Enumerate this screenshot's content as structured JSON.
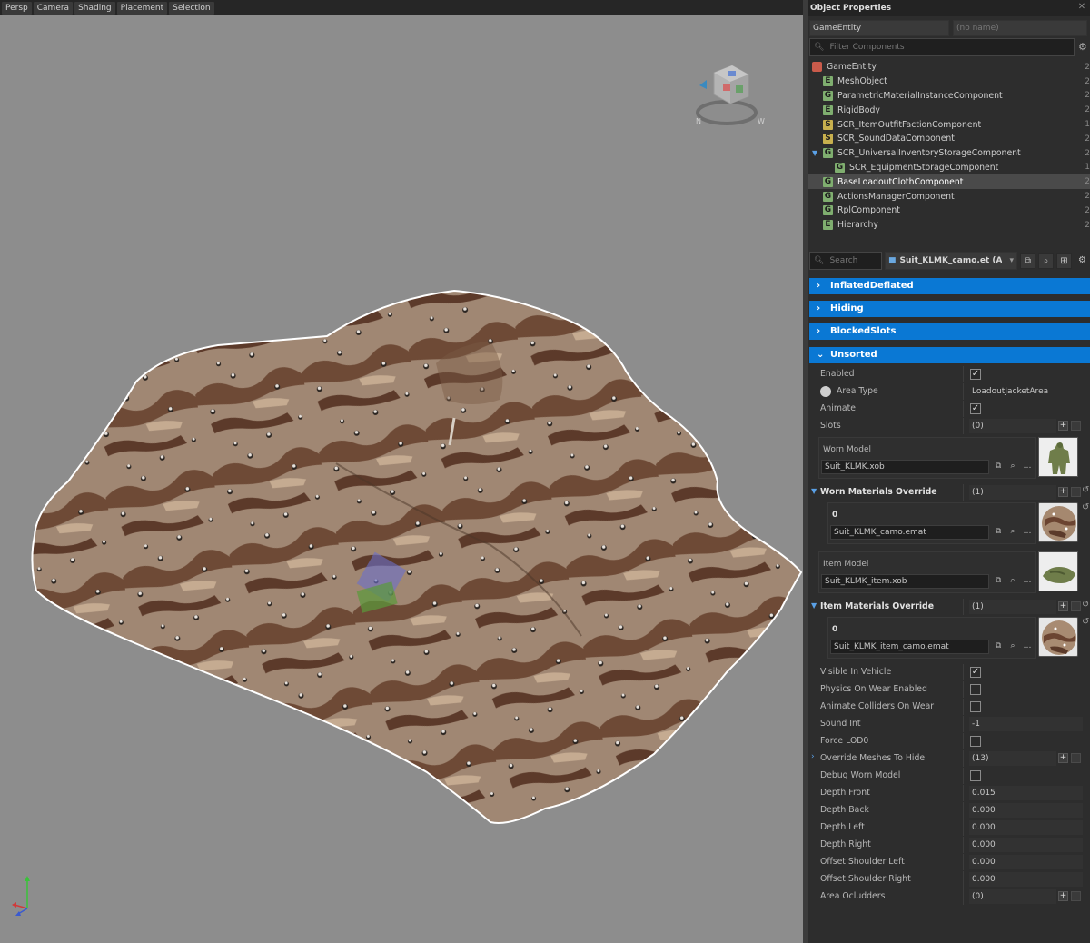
{
  "viewport": {
    "menu": [
      "Persp",
      "Camera",
      "Shading",
      "Placement",
      "Selection"
    ],
    "gizmo_labels": [
      "N",
      "W"
    ]
  },
  "panel": {
    "title": "Object Properties",
    "entity_type": "GameEntity",
    "entity_name": "(no name)",
    "filter_placeholder": "Filter Components",
    "search_placeholder": "Search",
    "prefab_file": "Suit_KLMK_camo.et (A"
  },
  "tree": [
    {
      "badge": "cube",
      "label": "GameEntity",
      "indent": 0,
      "num": "2"
    },
    {
      "badge": "E",
      "label": "MeshObject",
      "indent": 1,
      "num": "2"
    },
    {
      "badge": "G",
      "label": "ParametricMaterialInstanceComponent",
      "indent": 1,
      "num": "2"
    },
    {
      "badge": "E",
      "label": "RigidBody",
      "indent": 1,
      "num": "2"
    },
    {
      "badge": "S",
      "label": "SCR_ItemOutfitFactionComponent",
      "indent": 1,
      "num": "1"
    },
    {
      "badge": "S",
      "label": "SCR_SoundDataComponent",
      "indent": 1,
      "num": "2"
    },
    {
      "badge": "G",
      "label": "SCR_UniversalInventoryStorageComponent",
      "indent": 1,
      "num": "2",
      "expanded": true
    },
    {
      "badge": "G",
      "label": "SCR_EquipmentStorageComponent",
      "indent": 2,
      "num": "1"
    },
    {
      "badge": "G",
      "label": "BaseLoadoutClothComponent",
      "indent": 1,
      "num": "2",
      "selected": true
    },
    {
      "badge": "G",
      "label": "ActionsManagerComponent",
      "indent": 1,
      "num": "2"
    },
    {
      "badge": "G",
      "label": "RplComponent",
      "indent": 1,
      "num": "2"
    },
    {
      "badge": "E",
      "label": "Hierarchy",
      "indent": 1,
      "num": "2"
    }
  ],
  "categories": [
    "InflatedDeflated",
    "Hiding",
    "BlockedSlots",
    "Unsorted"
  ],
  "props": {
    "enabled": "Enabled",
    "area_type": "Area Type",
    "area_type_value": "LoadoutJacketArea",
    "animate": "Animate",
    "slots": "Slots",
    "slots_count": "(0)",
    "worn_model": "Worn Model",
    "worn_model_file": "Suit_KLMK.xob",
    "worn_materials_override": "Worn Materials Override",
    "worn_materials_count": "(1)",
    "worn_material_index": "0",
    "worn_material_file": "Suit_KLMK_camo.emat",
    "item_model": "Item Model",
    "item_model_file": "Suit_KLMK_item.xob",
    "item_materials_override": "Item Materials Override",
    "item_materials_count": "(1)",
    "item_material_index": "0",
    "item_material_file": "Suit_KLMK_item_camo.emat",
    "visible_in_vehicle": "Visible In Vehicle",
    "physics_on_wear": "Physics On Wear Enabled",
    "animate_colliders": "Animate Colliders On Wear",
    "sound_int": "Sound Int",
    "sound_int_value": "-1",
    "force_lod0": "Force LOD0",
    "override_meshes": "Override Meshes To Hide",
    "override_meshes_count": "(13)",
    "debug_worn_model": "Debug Worn Model",
    "depth_front": "Depth Front",
    "depth_front_value": "0.015",
    "depth_back": "Depth Back",
    "depth_back_value": "0.000",
    "depth_left": "Depth Left",
    "depth_left_value": "0.000",
    "depth_right": "Depth Right",
    "depth_right_value": "0.000",
    "offset_shoulder_left": "Offset Shoulder Left",
    "offset_shoulder_left_value": "0.000",
    "offset_shoulder_right": "Offset Shoulder Right",
    "offset_shoulder_right_value": "0.000",
    "area_ocludders": "Area Ocludders",
    "area_ocludders_count": "(0)"
  },
  "checks": {
    "enabled": true,
    "animate": true,
    "visible_in_vehicle": true,
    "physics_on_wear": false,
    "animate_colliders": false,
    "force_lod0": false,
    "debug_worn_model": false
  },
  "colors": {
    "category_blue": "#0a78d4",
    "viewport_bg": "#8d8d8d",
    "panel_bg": "#2d2d2d"
  }
}
